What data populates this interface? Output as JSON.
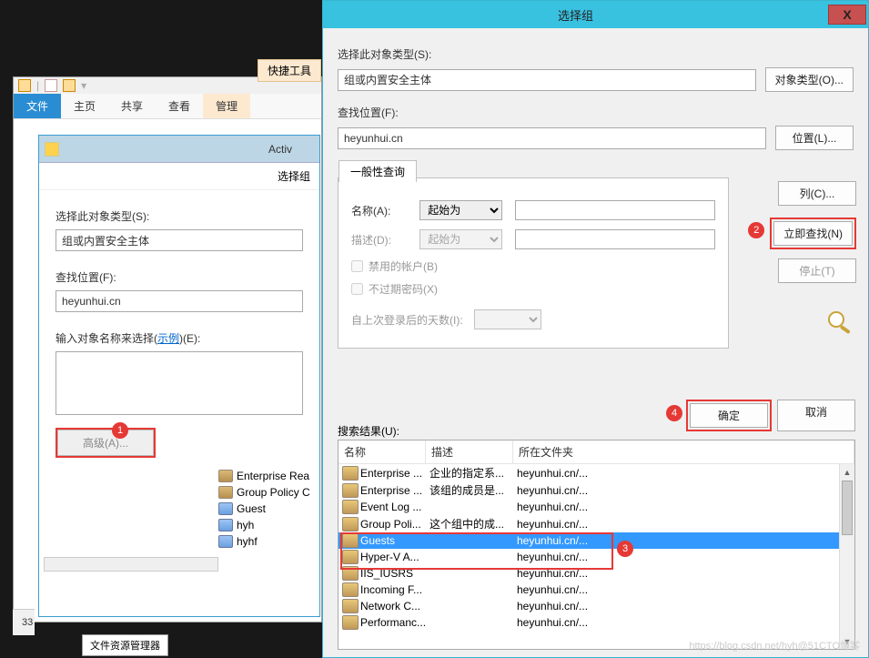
{
  "explorer": {
    "tabs": {
      "file": "文件",
      "home": "主页",
      "share": "共享",
      "view": "查看",
      "manage": "管理"
    },
    "quick_tools": "快捷工具",
    "activ": "Activ"
  },
  "back_dlg": {
    "title": "选择组",
    "obj_type_label": "选择此对象类型(S):",
    "obj_type_value": "组或内置安全主体",
    "location_label": "查找位置(F):",
    "location_value": "heyunhui.cn",
    "names_label_prefix": "输入对象名称来选择(",
    "names_label_link": "示例",
    "names_label_suffix": ")(E):",
    "advanced_btn": "高级(A)...",
    "marker1": "1"
  },
  "tree": {
    "items": [
      {
        "label": "Enterprise Rea",
        "type": "group"
      },
      {
        "label": "Group Policy C",
        "type": "group"
      },
      {
        "label": "Guest",
        "type": "user"
      },
      {
        "label": "hyh",
        "type": "user"
      },
      {
        "label": "hyhf",
        "type": "user"
      }
    ]
  },
  "status_count": "33",
  "taskbar": "文件资源管理器",
  "dlg": {
    "title": "选择组",
    "close": "X",
    "obj_type_label": "选择此对象类型(S):",
    "obj_type_value": "组或内置安全主体",
    "obj_type_btn": "对象类型(O)...",
    "location_label": "查找位置(F):",
    "location_value": "heyunhui.cn",
    "location_btn": "位置(L)...",
    "tab_label": "一般性查询",
    "name_label": "名称(A):",
    "name_op": "起始为",
    "desc_label": "描述(D):",
    "desc_op": "起始为",
    "cbx_disabled": "禁用的帐户(B)",
    "cbx_noexpire": "不过期密码(X)",
    "days_label": "自上次登录后的天数(I):",
    "col_btn": "列(C)...",
    "find_btn": "立即查找(N)",
    "stop_btn": "停止(T)",
    "ok_btn": "确定",
    "cancel_btn": "取消",
    "results_label": "搜索结果(U):",
    "marker2": "2",
    "marker3": "3",
    "marker4": "4",
    "columns": {
      "name": "名称",
      "desc": "描述",
      "folder": "所在文件夹"
    },
    "rows": [
      {
        "name": "Enterprise ...",
        "desc": "企业的指定系...",
        "folder": "heyunhui.cn/..."
      },
      {
        "name": "Enterprise ...",
        "desc": "该组的成员是...",
        "folder": "heyunhui.cn/..."
      },
      {
        "name": "Event Log ...",
        "desc": "",
        "folder": "heyunhui.cn/..."
      },
      {
        "name": "Group Poli...",
        "desc": "这个组中的成...",
        "folder": "heyunhui.cn/..."
      },
      {
        "name": "Guests",
        "desc": "",
        "folder": "heyunhui.cn/...",
        "selected": true
      },
      {
        "name": "Hyper-V A...",
        "desc": "",
        "folder": "heyunhui.cn/..."
      },
      {
        "name": "IIS_IUSRS",
        "desc": "",
        "folder": "heyunhui.cn/..."
      },
      {
        "name": "Incoming F...",
        "desc": "",
        "folder": "heyunhui.cn/..."
      },
      {
        "name": "Network C...",
        "desc": "",
        "folder": "heyunhui.cn/..."
      },
      {
        "name": "Performanc...",
        "desc": "",
        "folder": "heyunhui.cn/..."
      }
    ]
  },
  "watermark": "https://blog.csdn.net/hyh@51CTO博客"
}
